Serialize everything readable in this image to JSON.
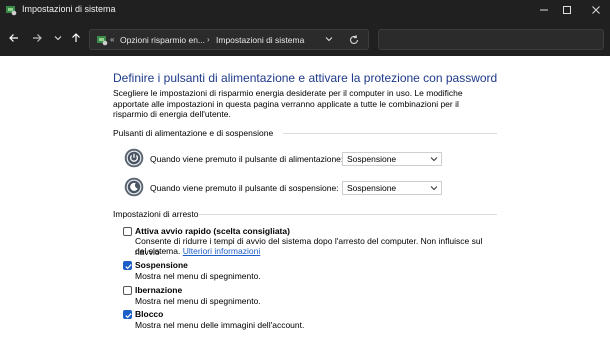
{
  "window": {
    "title": "Impostazioni di sistema"
  },
  "address": {
    "crumb1": "Opzioni risparmio en...",
    "crumb2": "Impostazioni di sistema",
    "chevrons": "«",
    "separator": "›"
  },
  "search": {
    "placeholder": ""
  },
  "page": {
    "heading": "Definire i pulsanti di alimentazione e attivare la protezione con password",
    "description": "Scegliere le impostazioni di risparmio energia desiderate per il computer in uso. Le modifiche apportate alle impostazioni in questa pagina verranno applicate a tutte le combinazioni per il risparmio di energia dell'utente."
  },
  "buttons_section": {
    "label": "Pulsanti di alimentazione e di sospensione",
    "rows": [
      {
        "label": "Quando viene premuto il pulsante di alimentazione:",
        "value": "Sospensione"
      },
      {
        "label": "Quando viene premuto il pulsante di sospensione:",
        "value": "Sospensione"
      }
    ]
  },
  "shutdown_section": {
    "label": "Impostazioni di arresto",
    "items": [
      {
        "title": "Attiva avvio rapido (scelta consigliata)",
        "checked": false,
        "desc": "Consente di ridurre i tempi di avvio del sistema dopo l'arresto del computer. Non influisce sul riavvio",
        "desc2": "del sistema.",
        "link": "Ulteriori informazioni"
      },
      {
        "title": "Sospensione",
        "checked": true,
        "desc": "Mostra nel menu di spegnimento."
      },
      {
        "title": "Ibernazione",
        "checked": false,
        "desc": "Mostra nel menu di spegnimento."
      },
      {
        "title": "Blocco",
        "checked": true,
        "desc": "Mostra nel menu delle immagini dell'account."
      }
    ]
  },
  "icons": {
    "back": "arrow-left-icon",
    "forward": "arrow-right-icon",
    "recent": "chevron-down-icon",
    "up": "arrow-up-icon",
    "refresh": "refresh-icon",
    "power": "power-button-icon",
    "sleep": "sleep-button-icon"
  },
  "colors": {
    "heading": "#1e3a8a",
    "link": "#1e5ec8",
    "checkbox_checked": "#1e5ec8",
    "titlebar": "#202020"
  }
}
